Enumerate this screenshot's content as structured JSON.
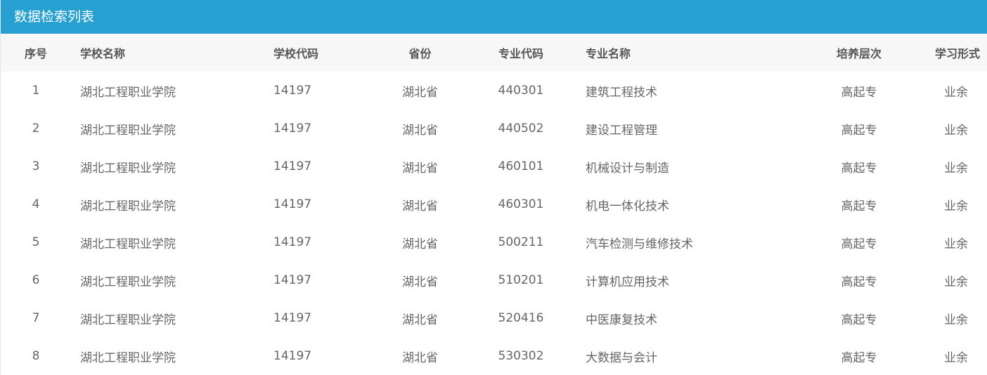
{
  "panel": {
    "title": "数据检索列表"
  },
  "table": {
    "headers": {
      "index": "序号",
      "school_name": "学校名称",
      "school_code": "学校代码",
      "province": "省份",
      "major_code": "专业代码",
      "major_name": "专业名称",
      "level": "培养层次",
      "study_mode": "学习形式"
    },
    "rows": [
      {
        "index": "1",
        "school_name": "湖北工程职业学院",
        "school_code": "14197",
        "province": "湖北省",
        "major_code": "440301",
        "major_name": "建筑工程技术",
        "level": "高起专",
        "study_mode": "业余"
      },
      {
        "index": "2",
        "school_name": "湖北工程职业学院",
        "school_code": "14197",
        "province": "湖北省",
        "major_code": "440502",
        "major_name": "建设工程管理",
        "level": "高起专",
        "study_mode": "业余"
      },
      {
        "index": "3",
        "school_name": "湖北工程职业学院",
        "school_code": "14197",
        "province": "湖北省",
        "major_code": "460101",
        "major_name": "机械设计与制造",
        "level": "高起专",
        "study_mode": "业余"
      },
      {
        "index": "4",
        "school_name": "湖北工程职业学院",
        "school_code": "14197",
        "province": "湖北省",
        "major_code": "460301",
        "major_name": "机电一体化技术",
        "level": "高起专",
        "study_mode": "业余"
      },
      {
        "index": "5",
        "school_name": "湖北工程职业学院",
        "school_code": "14197",
        "province": "湖北省",
        "major_code": "500211",
        "major_name": "汽车检测与维修技术",
        "level": "高起专",
        "study_mode": "业余"
      },
      {
        "index": "6",
        "school_name": "湖北工程职业学院",
        "school_code": "14197",
        "province": "湖北省",
        "major_code": "510201",
        "major_name": "计算机应用技术",
        "level": "高起专",
        "study_mode": "业余"
      },
      {
        "index": "7",
        "school_name": "湖北工程职业学院",
        "school_code": "14197",
        "province": "湖北省",
        "major_code": "520416",
        "major_name": "中医康复技术",
        "level": "高起专",
        "study_mode": "业余"
      },
      {
        "index": "8",
        "school_name": "湖北工程职业学院",
        "school_code": "14197",
        "province": "湖北省",
        "major_code": "530302",
        "major_name": "大数据与会计",
        "level": "高起专",
        "study_mode": "业余"
      }
    ]
  }
}
